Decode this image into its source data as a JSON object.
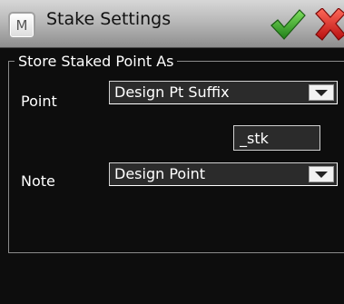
{
  "window": {
    "title": "Stake Settings",
    "menu_glyph": "M"
  },
  "group": {
    "title": "Store Staked Point As"
  },
  "point": {
    "label": "Point",
    "selected": "Design Pt Suffix"
  },
  "suffix": {
    "value": "_stk"
  },
  "note": {
    "label": "Note",
    "selected": "Design Point"
  },
  "colors": {
    "accept": "#3aa82a",
    "cancel": "#d42020",
    "background": "#0d0d0d",
    "field": "#2b2b2b"
  },
  "icons": {
    "menu": "menu-icon",
    "accept": "checkmark-icon",
    "cancel": "close-icon",
    "dropdown": "chevron-down-icon"
  }
}
